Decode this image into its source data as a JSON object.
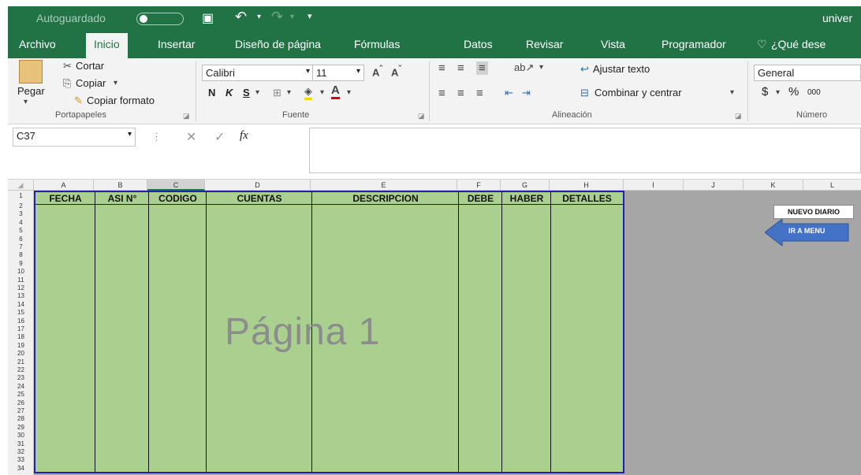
{
  "titlebar": {
    "autosave_label": "Autoguardado",
    "file_name": "univer"
  },
  "tabs": [
    {
      "label": "Archivo"
    },
    {
      "label": "Inicio"
    },
    {
      "label": "Insertar"
    },
    {
      "label": "Diseño de página"
    },
    {
      "label": "Fórmulas"
    },
    {
      "label": "Datos"
    },
    {
      "label": "Revisar"
    },
    {
      "label": "Vista"
    },
    {
      "label": "Programador"
    },
    {
      "label": "¿Qué dese"
    }
  ],
  "ribbon": {
    "paste": "Pegar",
    "cut": "Cortar",
    "copy": "Copiar",
    "format_painter": "Copiar formato",
    "group_clipboard": "Portapapeles",
    "font_name": "Calibri",
    "font_size": "11",
    "bold": "N",
    "italic": "K",
    "underline": "S",
    "group_font": "Fuente",
    "wrap_text": "Ajustar texto",
    "merge_center": "Combinar y centrar",
    "group_alignment": "Alineación",
    "number_format": "General",
    "currency": "$",
    "percent": "%",
    "thousands": "000",
    "group_number": "Número"
  },
  "formula_bar": {
    "name_box": "C37",
    "fx": "fx",
    "formula": ""
  },
  "columns": [
    "A",
    "B",
    "C",
    "D",
    "E",
    "F",
    "G",
    "H",
    "I",
    "J",
    "K",
    "L"
  ],
  "rows": [
    "1",
    "2",
    "3",
    "4",
    "5",
    "6",
    "7",
    "8",
    "9",
    "10",
    "11",
    "12",
    "13",
    "14",
    "15",
    "16",
    "17",
    "18",
    "19",
    "20",
    "21",
    "22",
    "23",
    "24",
    "25",
    "26",
    "27",
    "28",
    "29",
    "30",
    "31",
    "32",
    "33",
    "34"
  ],
  "table_headers": [
    "FECHA",
    "ASI N°",
    "CODIGO",
    "CUENTAS",
    "DESCRIPCION",
    "DEBE",
    "HABER",
    "DETALLES"
  ],
  "watermark": "Página 1",
  "buttons": {
    "new_journal": "NUEVO DIARIO",
    "go_menu": "IR A MENU"
  },
  "colors": {
    "excel_green": "#217346",
    "table_fill": "#a9d08e",
    "page_border": "#1f1fb4",
    "arrow_blue": "#4472c4"
  }
}
